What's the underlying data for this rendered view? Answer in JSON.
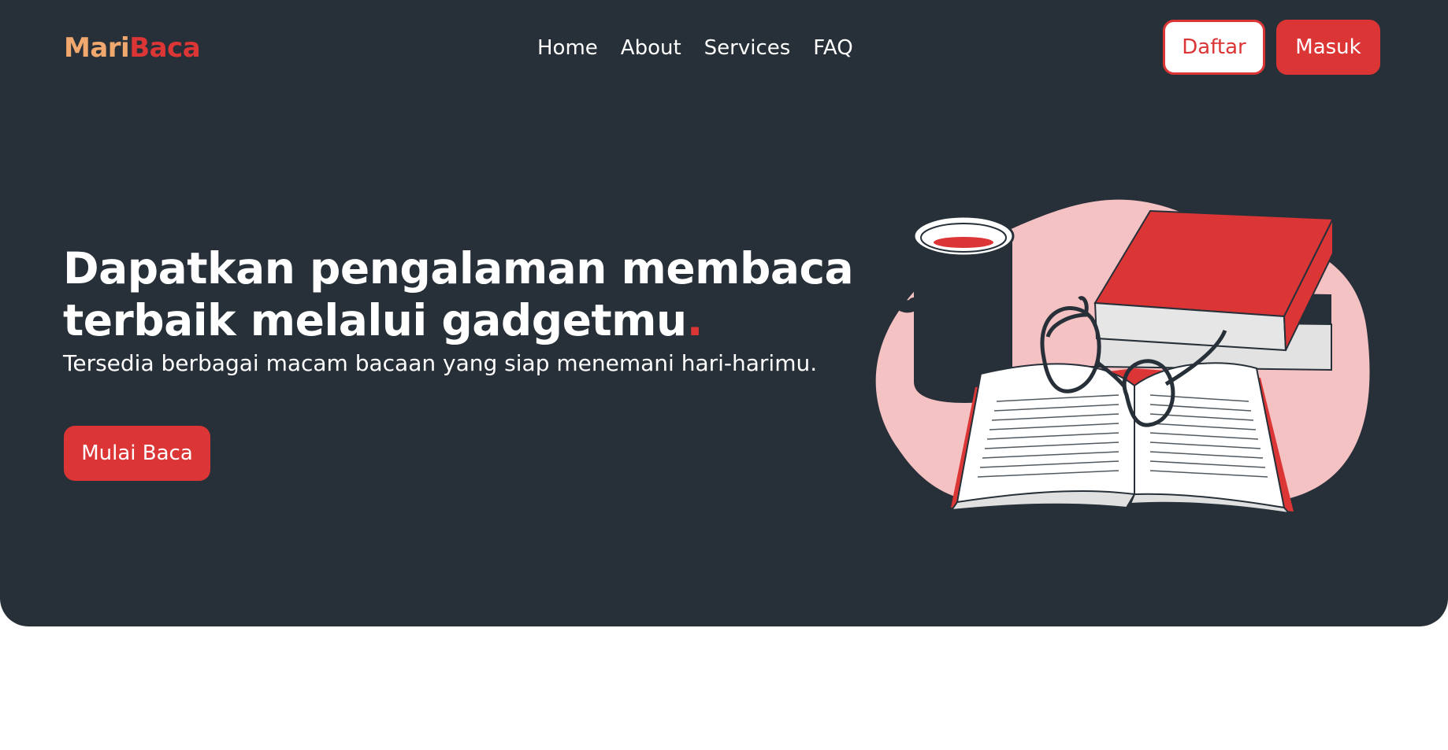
{
  "brand": {
    "part1": "Mari",
    "part2": "Baca"
  },
  "nav": {
    "links": [
      "Home",
      "About",
      "Services",
      "FAQ"
    ]
  },
  "auth": {
    "register_label": "Daftar",
    "login_label": "Masuk"
  },
  "hero": {
    "headline_line1": "Dapatkan pengalaman membaca",
    "headline_line2": "terbaik melalui gadgetmu",
    "headline_dot": ".",
    "subtitle": "Tersedia berbagai macam bacaan yang siap menemani hari-harimu.",
    "cta_label": "Mulai Baca"
  },
  "colors": {
    "background_dark": "#273038",
    "accent_red": "#dc3536",
    "brand_orange": "#f0a86e",
    "blob_pink": "#f5c2c4"
  },
  "illustration": {
    "icons": [
      "coffee-mug-icon",
      "book-stack-icon",
      "open-book-icon",
      "eyeglasses-icon"
    ]
  }
}
